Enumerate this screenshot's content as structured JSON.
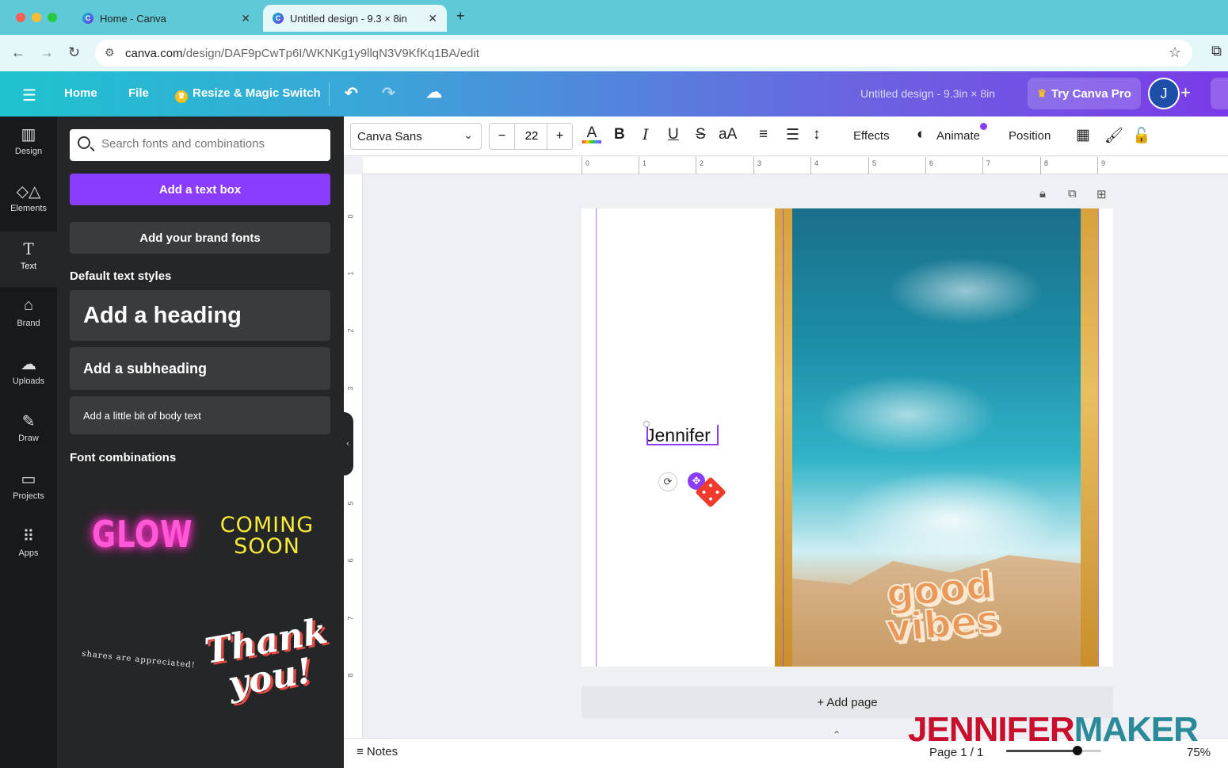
{
  "browser": {
    "tabs": [
      {
        "title": "Home - Canva"
      },
      {
        "title": "Untitled design - 9.3 × 8in"
      }
    ],
    "url_host": "canva.com",
    "url_path": "/design/DAF9pCwTp6I/WKNKg1y9llqN3V9KfKq1BA/edit"
  },
  "header": {
    "home": "Home",
    "file": "File",
    "resize": "Resize & Magic Switch",
    "title": "Untitled design - 9.3in × 8in",
    "try_pro": "Try Canva Pro",
    "avatar_initial": "J"
  },
  "rail": {
    "items": [
      {
        "label": "Design",
        "icon": "design-icon"
      },
      {
        "label": "Elements",
        "icon": "elements-icon"
      },
      {
        "label": "Text",
        "icon": "text-icon"
      },
      {
        "label": "Brand",
        "icon": "brand-icon"
      },
      {
        "label": "Uploads",
        "icon": "upload-cloud-icon"
      },
      {
        "label": "Draw",
        "icon": "draw-icon"
      },
      {
        "label": "Projects",
        "icon": "folder-icon"
      },
      {
        "label": "Apps",
        "icon": "apps-grid-icon"
      }
    ]
  },
  "panel": {
    "search_placeholder": "Search fonts and combinations",
    "add_text_box": "Add a text box",
    "add_brand_fonts": "Add your brand fonts",
    "default_styles_label": "Default text styles",
    "heading": "Add a heading",
    "subheading": "Add a subheading",
    "body": "Add a little bit of body text",
    "combinations_label": "Font combinations",
    "combo_glow": "GLOW",
    "combo_coming_1": "COMING",
    "combo_coming_2": "SOON",
    "combo_shares": "shares are appreciated!",
    "combo_thank_1": "Thank",
    "combo_thank_2": "you!"
  },
  "toolbar": {
    "font": "Canva Sans",
    "size": "22",
    "effects": "Effects",
    "animate": "Animate",
    "position": "Position"
  },
  "ruler": {
    "top": [
      "0",
      "1",
      "2",
      "3",
      "4",
      "5",
      "6",
      "7",
      "8",
      "9"
    ],
    "left": [
      "0",
      "1",
      "2",
      "3",
      "4",
      "5",
      "6",
      "7",
      "8"
    ]
  },
  "canvas": {
    "text_value": "Jennifer",
    "sticker_text_1": "good",
    "sticker_text_2": "vibes"
  },
  "add_page": "+ Add page",
  "footer": {
    "notes": "Notes",
    "page": "Page 1 / 1",
    "zoom": "75%",
    "zoom_fraction": 0.75
  },
  "watermark": {
    "part1": "JENNIFER",
    "part2": "MAKER"
  },
  "colors": {
    "accent": "#8b3dff",
    "watermark_red": "#c8102e",
    "watermark_teal": "#2a8a9a"
  }
}
